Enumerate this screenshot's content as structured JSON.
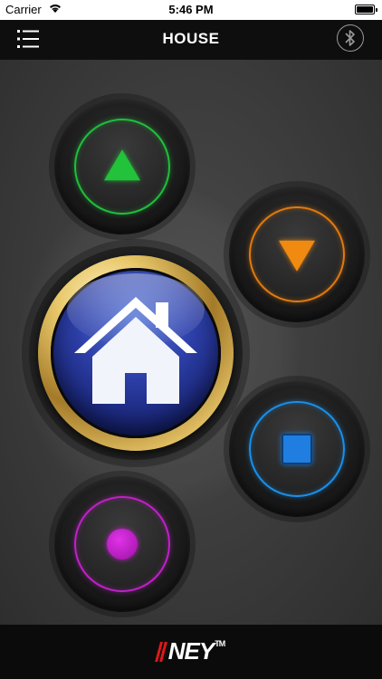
{
  "status_bar": {
    "carrier": "Carrier",
    "time": "5:46 PM"
  },
  "nav": {
    "title": "HOUSE",
    "menu_icon": "list-icon",
    "right_icon": "bluetooth-icon"
  },
  "controls": {
    "up": {
      "icon": "triangle-up-icon",
      "color": "#22c23a"
    },
    "down": {
      "icon": "triangle-down-icon",
      "color": "#f08a10"
    },
    "stop": {
      "icon": "stop-square-icon",
      "color": "#1f7ee0"
    },
    "record": {
      "icon": "record-dot-icon",
      "color": "#c020c8"
    },
    "home": {
      "icon": "house-icon",
      "color": "#2d3fa8",
      "ring_color": "#e2c064"
    }
  },
  "footer": {
    "logo_text": "NEY",
    "trademark": "TM",
    "logo_accent": "#e01818"
  }
}
